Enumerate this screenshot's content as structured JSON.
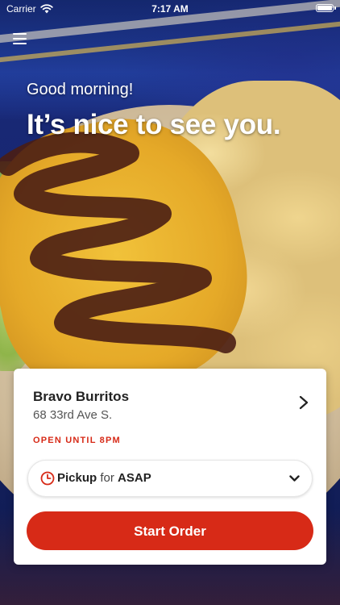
{
  "status_bar": {
    "carrier": "Carrier",
    "time": "7:17 AM"
  },
  "greeting": {
    "line1": "Good morning!",
    "line2": "It’s nice to see you."
  },
  "store": {
    "name": "Bravo Burritos",
    "address": "68 33rd Ave S.",
    "hours_status": "OPEN UNTIL 8PM"
  },
  "order_type": {
    "mode": "Pickup",
    "connector": "for",
    "time": "ASAP"
  },
  "actions": {
    "start_order_label": "Start Order"
  },
  "icons": {
    "menu": "hamburger-menu-icon",
    "wifi": "wifi-icon",
    "battery": "battery-icon",
    "store_chevron": "chevron-right-icon",
    "clock": "clock-icon",
    "dropdown": "chevron-down-icon"
  },
  "colors": {
    "accent": "#d72a17",
    "card_background": "#ffffff",
    "primary_text": "#222222",
    "secondary_text": "#555555"
  }
}
